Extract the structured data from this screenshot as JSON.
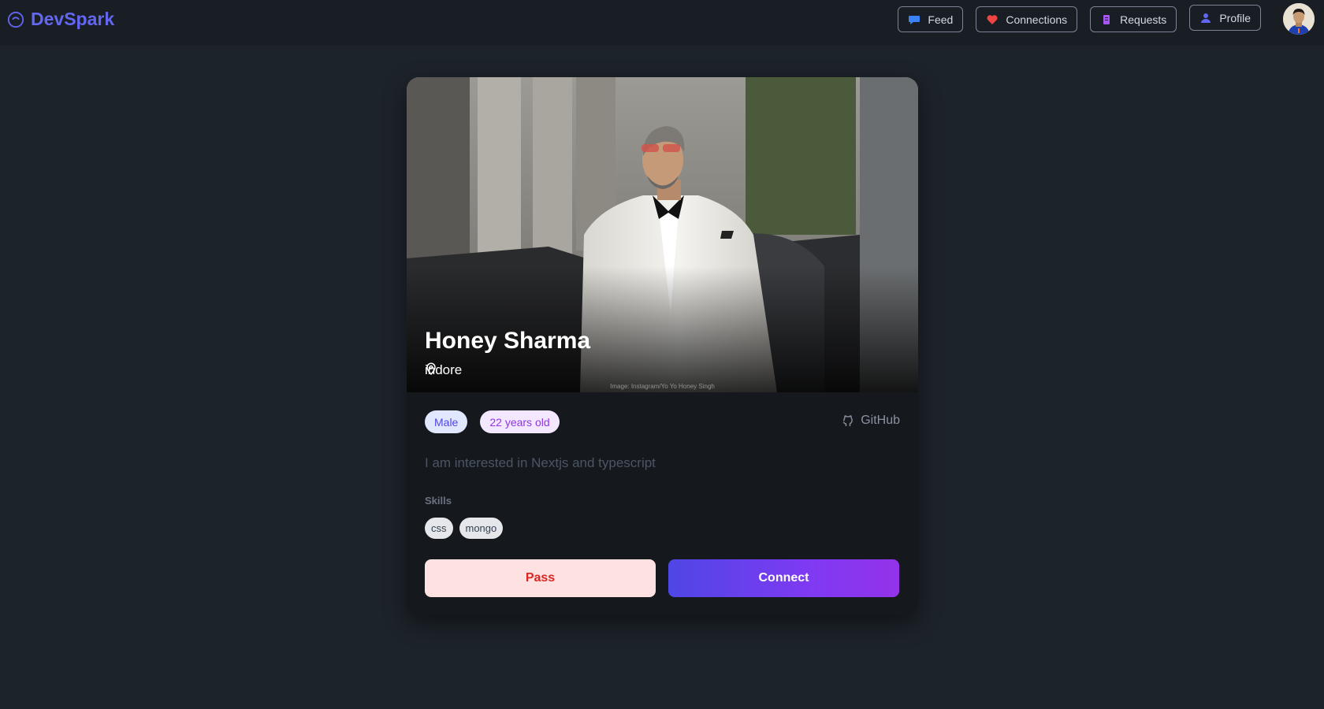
{
  "app": {
    "brand": "DevSpark",
    "brand_icon": "circle-smile-icon"
  },
  "nav": {
    "items": [
      {
        "label": "Feed",
        "icon": "chat-bubble-icon",
        "color": "#3b82f6"
      },
      {
        "label": "Connections",
        "icon": "heart-icon",
        "color": "#ef4444"
      },
      {
        "label": "Requests",
        "icon": "document-icon",
        "color": "#a855f7"
      },
      {
        "label": "Profile",
        "icon": "user-icon",
        "color": "#6366f1"
      }
    ],
    "avatar": "avatar"
  },
  "profile": {
    "name": "Honey Sharma",
    "location": "indore",
    "photo_credit": "Image: Instagram/Yo Yo Honey Singh",
    "gender": "Male",
    "age": "22 years old",
    "github_label": "GitHub",
    "about": "I am interested in Nextjs and typescript",
    "skills_label": "Skills",
    "skills": [
      "css",
      "mongo"
    ]
  },
  "actions": {
    "pass_label": "Pass",
    "connect_label": "Connect"
  },
  "colors": {
    "background": "#1d232a",
    "navbar": "#191e24",
    "card": "#15191e",
    "brand": "#6366f1",
    "pass_bg": "#fee2e2",
    "pass_text": "#dc2626",
    "connect_from": "#4f46e5",
    "connect_to": "#9333ea"
  }
}
